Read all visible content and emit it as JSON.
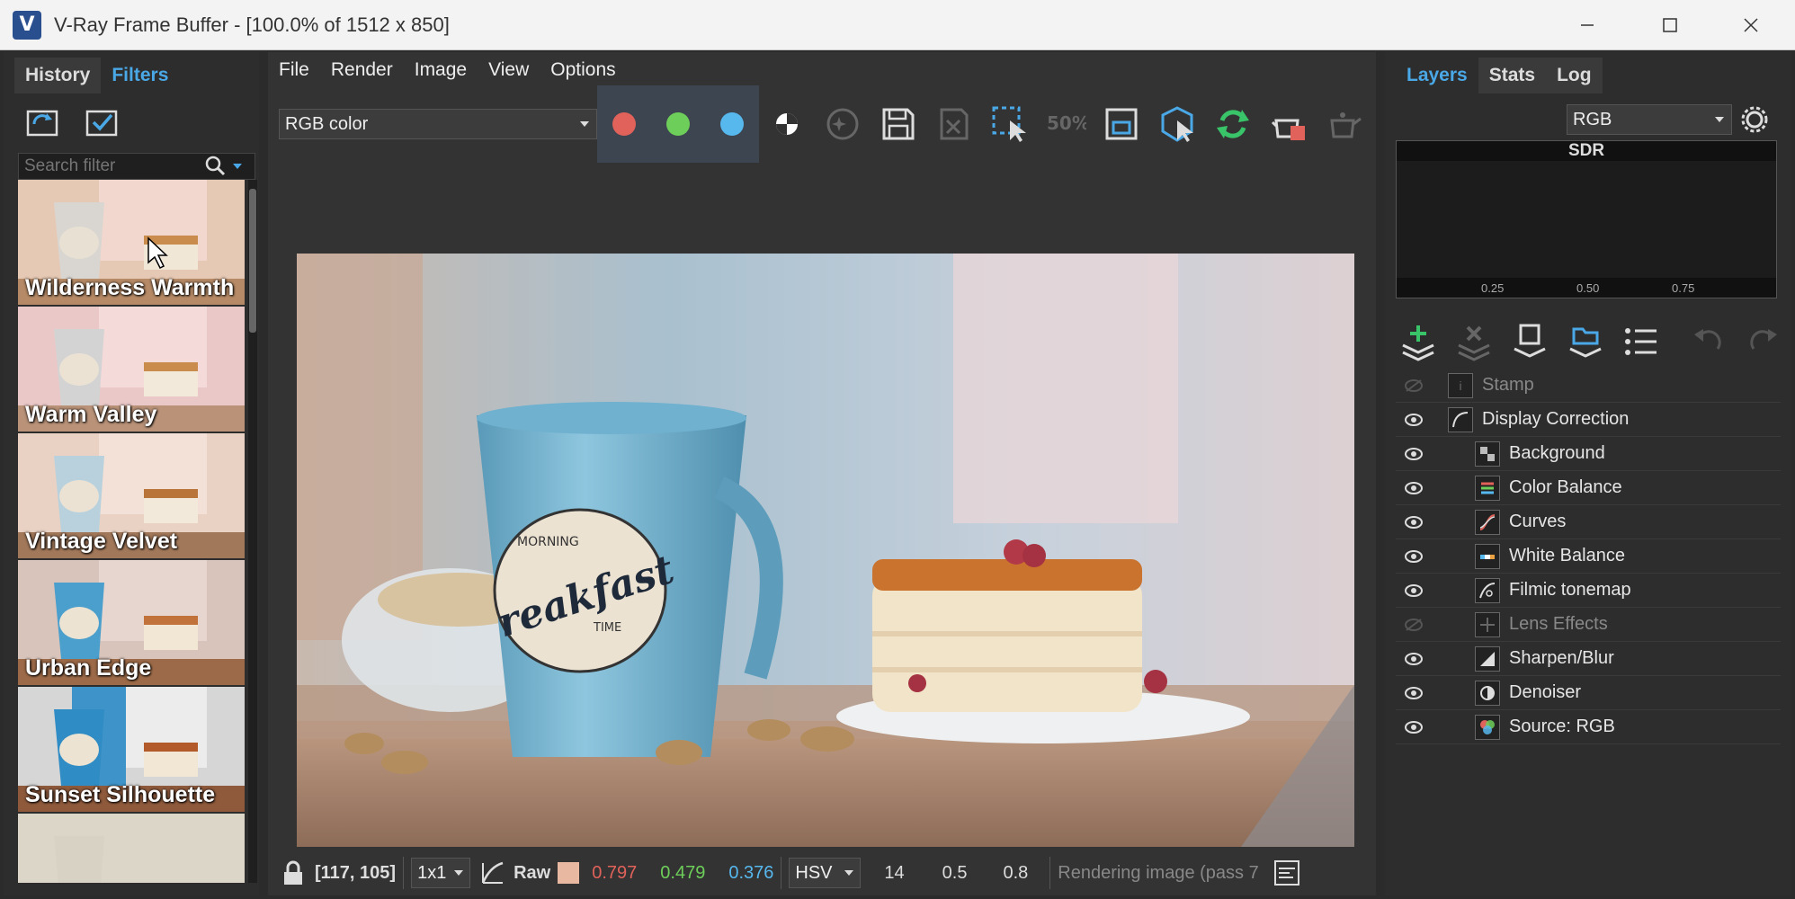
{
  "window": {
    "logo": "V",
    "title": "V-Ray Frame Buffer - [100.0% of 1512 x 850]",
    "controls": [
      "minimize-icon",
      "maximize-icon",
      "close-icon"
    ]
  },
  "left_panel": {
    "tabs": [
      {
        "label": "History",
        "active": false
      },
      {
        "label": "Filters",
        "active": true
      }
    ],
    "search": {
      "placeholder": "Search filter"
    },
    "filters": [
      {
        "label": "Wilderness Warmth"
      },
      {
        "label": "Warm Valley"
      },
      {
        "label": "Vintage Velvet"
      },
      {
        "label": "Urban Edge"
      },
      {
        "label": "Sunset Silhouette"
      },
      {
        "label": ""
      }
    ]
  },
  "center_panel": {
    "menu": [
      "File",
      "Render",
      "Image",
      "View",
      "Options"
    ],
    "channel_select": {
      "value": "RGB color"
    },
    "statusbar": {
      "coords": "[117, 105]",
      "zoom_select": "1x1",
      "raw_label": "Raw",
      "r": "0.797",
      "g": "0.479",
      "b": "0.376",
      "color_mode": "HSV",
      "h": "14",
      "s": "0.5",
      "v": "0.8",
      "render_status": "Rendering image (pass 7"
    },
    "image_text": {
      "brand1": "MORNING",
      "brand2": "reakfast",
      "brand3": "TIME"
    }
  },
  "right_panel": {
    "tabs": [
      {
        "label": "Layers",
        "active": true
      },
      {
        "label": "Stats",
        "active": false
      },
      {
        "label": "Log",
        "active": false
      }
    ],
    "channel_select": {
      "value": "RGB"
    },
    "histogram": {
      "header": "SDR",
      "ticks": [
        "0.25",
        "0.50",
        "0.75"
      ]
    },
    "layers": [
      {
        "name": "Stamp",
        "visible": false,
        "indent": 0,
        "dim": true
      },
      {
        "name": "Display Correction",
        "visible": true,
        "indent": 0,
        "dim": false
      },
      {
        "name": "Background",
        "visible": true,
        "indent": 1,
        "dim": false
      },
      {
        "name": "Color Balance",
        "visible": true,
        "indent": 1,
        "dim": false
      },
      {
        "name": "Curves",
        "visible": true,
        "indent": 1,
        "dim": false
      },
      {
        "name": "White Balance",
        "visible": true,
        "indent": 1,
        "dim": false
      },
      {
        "name": "Filmic tonemap",
        "visible": true,
        "indent": 1,
        "dim": false
      },
      {
        "name": "Lens Effects",
        "visible": false,
        "indent": 1,
        "dim": true
      },
      {
        "name": "Sharpen/Blur",
        "visible": true,
        "indent": 1,
        "dim": false
      },
      {
        "name": "Denoiser",
        "visible": true,
        "indent": 1,
        "dim": false
      },
      {
        "name": "Source: RGB",
        "visible": true,
        "indent": 1,
        "dim": false
      }
    ]
  },
  "colors": {
    "accent": "#4aa8e6",
    "red_value": "#e0625a",
    "green_value": "#6dcf5a",
    "blue_value": "#4aa8e6"
  }
}
